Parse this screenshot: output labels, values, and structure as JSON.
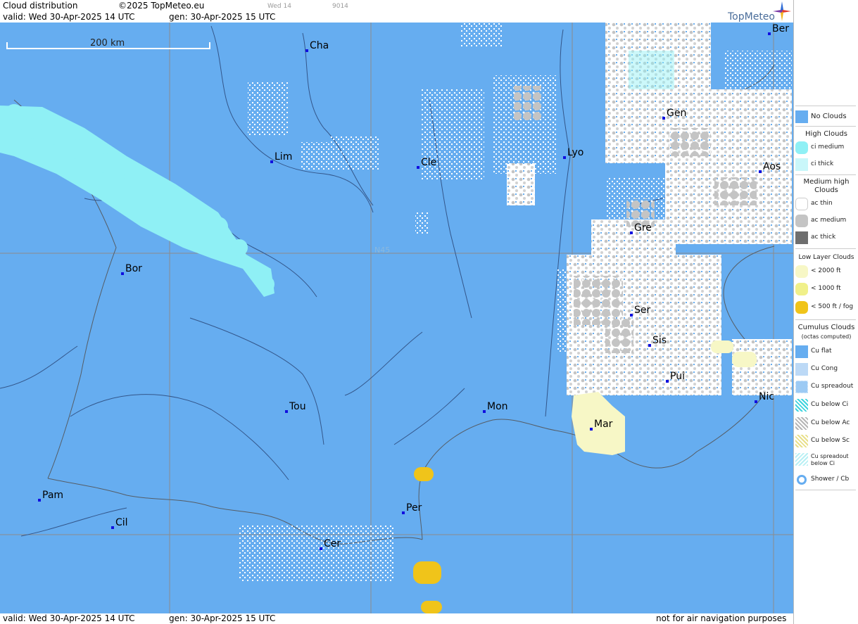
{
  "header": {
    "title": "Cloud distribution",
    "copyright": "©2025 TopMeteo.eu",
    "valid": "valid:  Wed  30-Apr-2025  14 UTC",
    "gen": "gen: 30-Apr-2025 15 UTC",
    "small_a": "Wed 14",
    "small_b": "9014",
    "logo": "TopMeteo"
  },
  "footer": {
    "valid": "valid:  Wed  30-Apr-2025  14 UTC",
    "gen": "gen: 30-Apr-2025 15 UTC",
    "disclaimer": "not for air navigation purposes"
  },
  "map": {
    "scale_label": "200 km",
    "lat_label": "N45",
    "cities": [
      "Ber",
      "Cha",
      "Gen",
      "Lim",
      "Cle",
      "Lyo",
      "Aos",
      "Gre",
      "Bor",
      "Ser",
      "Sis",
      "Pui",
      "Nic",
      "Tou",
      "Mon",
      "Mar",
      "Pam",
      "Per",
      "Cil",
      "Cer"
    ]
  },
  "legend": {
    "no_clouds": "No Clouds",
    "high_title": "High Clouds",
    "ci_medium": "ci medium",
    "ci_thick": "ci thick",
    "medium_title": "Medium high Clouds",
    "ac_thin": "ac thin",
    "ac_medium": "ac medium",
    "ac_thick": "ac thick",
    "low_title": "Low Layer Clouds",
    "low_2000": "< 2000 ft",
    "low_1000": "< 1000 ft",
    "low_500": "< 500 ft / fog",
    "cu_title": "Cumulus Clouds",
    "cu_subtitle": "(octas computed)",
    "cu_flat": "Cu flat",
    "cu_cong": "Cu Cong",
    "cu_spreadout": "Cu spreadout",
    "cu_below_ci": "Cu below Ci",
    "cu_below_ac": "Cu below Ac",
    "cu_below_sc": "Cu below Sc",
    "cu_spread_below_ci": "Cu spreadout below Ci",
    "shower": "Shower / Cb"
  },
  "colors": {
    "no_clouds": "#66adf0",
    "ci": "#8ff0f5",
    "ac_thin": "#ffffff",
    "ac_medium": "#c4c4c4",
    "ac_thick": "#6e6e6e",
    "low_2000": "#f7f7c6",
    "low_1000": "#f0f08a",
    "low_500": "#f0c41a"
  }
}
